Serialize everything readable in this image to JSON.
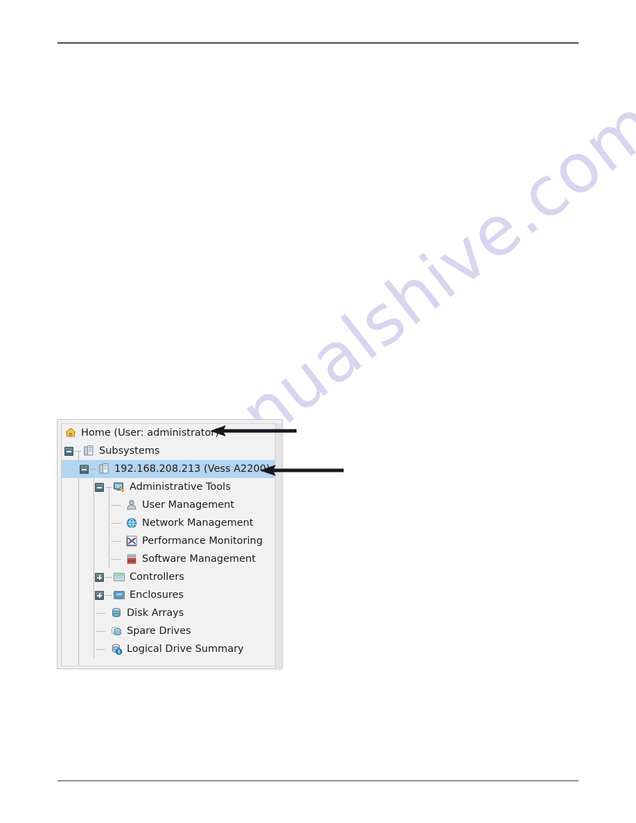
{
  "page": {
    "watermark": "manualshive.com",
    "rule_color": "#4a4a4a"
  },
  "tree_panel": {
    "background": "#efefef",
    "selection_color": "#b4d5ef",
    "items": [
      {
        "id": "home",
        "label": "Home (User: administrator)",
        "icon": "home-icon",
        "depth": 0,
        "expander": "none",
        "selected": false
      },
      {
        "id": "subsystems",
        "label": "Subsystems",
        "icon": "subsystems-icon",
        "depth": 0,
        "expander": "minus",
        "selected": false
      },
      {
        "id": "subsystem-node",
        "label": "192.168.208.213 (Vess A2200)",
        "icon": "subsystem-node-icon",
        "depth": 1,
        "expander": "minus",
        "selected": true
      },
      {
        "id": "administrative-tools",
        "label": "Administrative Tools",
        "icon": "administrative-tools-icon",
        "depth": 2,
        "expander": "minus",
        "selected": false
      },
      {
        "id": "user-management",
        "label": "User Management",
        "icon": "user-management-icon",
        "depth": 3,
        "expander": "none",
        "selected": false
      },
      {
        "id": "network-management",
        "label": "Network Management",
        "icon": "network-management-icon",
        "depth": 3,
        "expander": "none",
        "selected": false
      },
      {
        "id": "performance-monitoring",
        "label": "Performance Monitoring",
        "icon": "performance-monitoring-icon",
        "depth": 3,
        "expander": "none",
        "selected": false
      },
      {
        "id": "software-management",
        "label": "Software Management",
        "icon": "software-management-icon",
        "depth": 3,
        "expander": "none",
        "selected": false
      },
      {
        "id": "controllers",
        "label": "Controllers",
        "icon": "controllers-icon",
        "depth": 2,
        "expander": "plus",
        "selected": false
      },
      {
        "id": "enclosures",
        "label": "Enclosures",
        "icon": "enclosures-icon",
        "depth": 2,
        "expander": "plus",
        "selected": false
      },
      {
        "id": "disk-arrays",
        "label": "Disk Arrays",
        "icon": "disk-arrays-icon",
        "depth": 2,
        "expander": "none",
        "selected": false
      },
      {
        "id": "spare-drives",
        "label": "Spare Drives",
        "icon": "spare-drives-icon",
        "depth": 2,
        "expander": "none",
        "selected": false
      },
      {
        "id": "logical-drive-summary",
        "label": "Logical Drive Summary",
        "icon": "logical-drive-summary-icon",
        "depth": 2,
        "expander": "none",
        "selected": false
      }
    ]
  },
  "annotations": {
    "callouts": [
      {
        "id": "callout-home",
        "target": "home"
      },
      {
        "id": "callout-subsystem-node",
        "target": "subsystem-node"
      }
    ]
  }
}
